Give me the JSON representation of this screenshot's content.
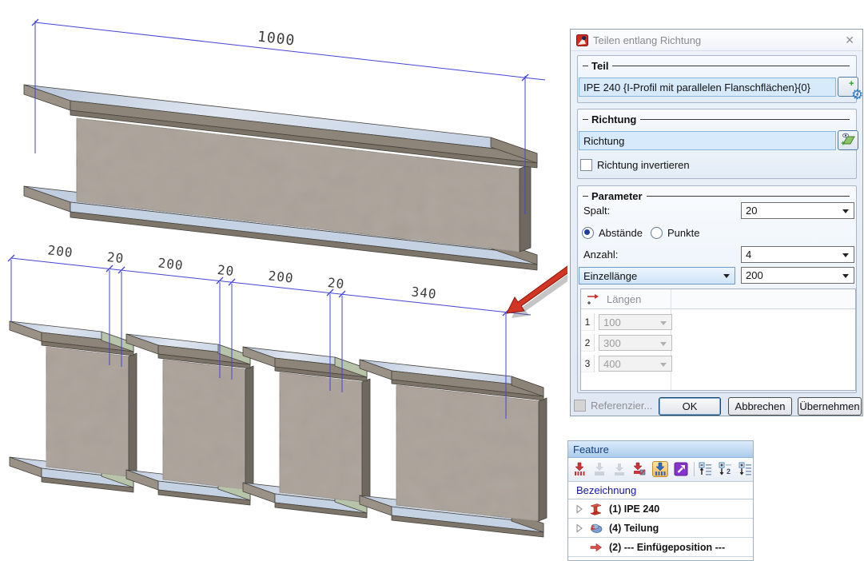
{
  "scene": {
    "top_dim_label": "1000",
    "dims": [
      "200",
      "20",
      "200",
      "20",
      "200",
      "20",
      "340"
    ]
  },
  "dialog": {
    "title": "Teilen entlang Richtung",
    "close_glyph": "✕",
    "teil": {
      "label": "Teil",
      "part_value": "IPE 240 {I-Profil mit parallelen Flanschflächen}{0}"
    },
    "richtung": {
      "label": "Richtung",
      "field_value": "Richtung",
      "invert_label": "Richtung invertieren"
    },
    "parameter": {
      "label": "Parameter",
      "spalt_label": "Spalt:",
      "spalt_value": "20",
      "abstaende_label": "Abstände",
      "punkte_label": "Punkte",
      "anzahl_label": "Anzahl:",
      "anzahl_value": "4",
      "mode_value": "Einzellänge",
      "einzel_value": "200",
      "table": {
        "header": "Längen",
        "rows": [
          {
            "num": "1",
            "value": "100"
          },
          {
            "num": "2",
            "value": "300"
          },
          {
            "num": "3",
            "value": "400"
          }
        ]
      }
    },
    "footer": {
      "referenz_label": "Referenzier...",
      "ok": "OK",
      "cancel": "Abbrechen",
      "apply": "Übernehmen"
    }
  },
  "feature": {
    "title": "Feature",
    "column_header": "Bezeichnung",
    "rows": [
      {
        "label": "(1) IPE 240"
      },
      {
        "label": "(4) Teilung"
      },
      {
        "label": "(2) --- Einfügeposition ---"
      }
    ]
  },
  "colors": {
    "dim_blue": "#4444d6",
    "arrow_red": "#d23523",
    "active_tool_orange": "#f8ba55",
    "flange_blue": "#c9d5e5",
    "web_gray": "#a79e95"
  }
}
